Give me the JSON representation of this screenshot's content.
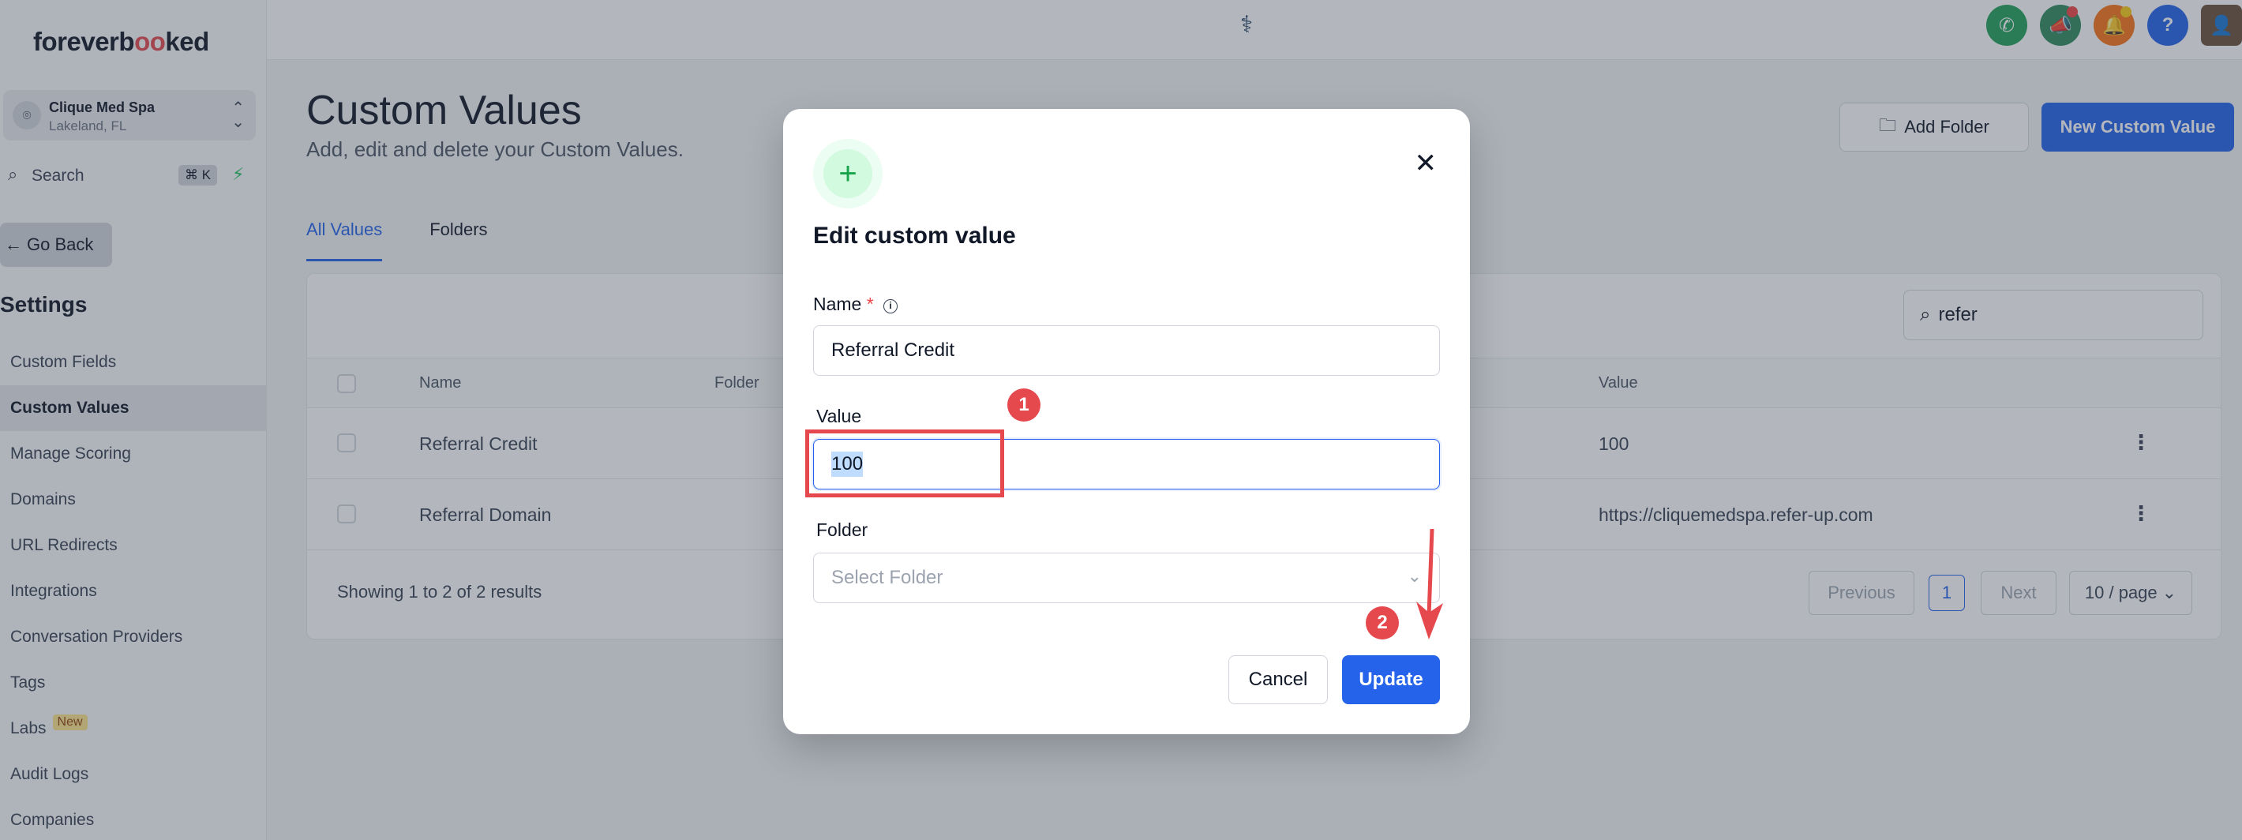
{
  "app": {
    "logo_text_a": "foreverb",
    "logo_text_oo": "oo",
    "logo_text_b": "ked"
  },
  "account": {
    "name": "Clique Med Spa",
    "location": "Lakeland, FL"
  },
  "search": {
    "label": "Search",
    "shortcut": "⌘ K"
  },
  "sidebar": {
    "go_back": "Go Back",
    "section_title": "Settings",
    "items": [
      {
        "label": "Custom Fields"
      },
      {
        "label": "Custom Values"
      },
      {
        "label": "Manage Scoring"
      },
      {
        "label": "Domains"
      },
      {
        "label": "URL Redirects"
      },
      {
        "label": "Integrations"
      },
      {
        "label": "Conversation Providers"
      },
      {
        "label": "Tags"
      },
      {
        "label": "Labs",
        "badge": "New"
      },
      {
        "label": "Audit Logs"
      },
      {
        "label": "Companies"
      }
    ]
  },
  "topbar": {
    "help": "?",
    "colors": {
      "phone": "#22a05a",
      "megaphone": "#2f8a5c",
      "bell": "#f97316",
      "help": "#2563eb"
    }
  },
  "page": {
    "title": "Custom Values",
    "subtitle": "Add, edit and delete your Custom Values.",
    "add_folder": "Add Folder",
    "new_custom_value": "New Custom Value",
    "tabs": [
      "All Values",
      "Folders"
    ]
  },
  "table": {
    "search_value": "refer",
    "headers": {
      "name": "Name",
      "folder": "Folder",
      "value": "Value"
    },
    "rows": [
      {
        "name": "Referral Credit",
        "value": "100"
      },
      {
        "name": "Referral Domain",
        "value": "https://cliquemedspa.refer-up.com"
      }
    ],
    "showing": "Showing 1 to 2 of 2 results",
    "pagination": {
      "previous": "Previous",
      "current": "1",
      "next": "Next",
      "per_page": "10 / page"
    }
  },
  "modal": {
    "title": "Edit custom value",
    "name_label": "Name",
    "required_mark": "*",
    "name_value": "Referral Credit",
    "value_label": "Value",
    "value_value": "100",
    "folder_label": "Folder",
    "folder_placeholder": "Select Folder",
    "cancel": "Cancel",
    "update": "Update"
  },
  "annotations": {
    "step1": "1",
    "step2": "2",
    "color": "#e5484d"
  }
}
